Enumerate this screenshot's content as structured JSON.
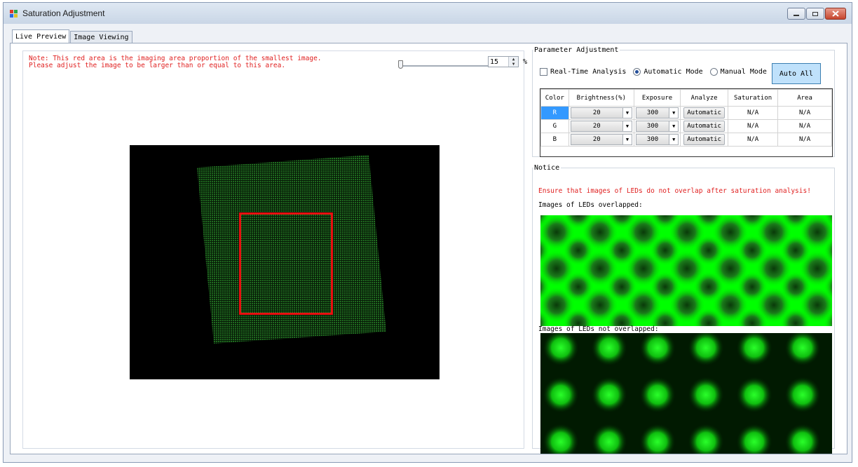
{
  "window": {
    "title": "Saturation Adjustment",
    "controls": [
      "minimize-icon",
      "maximize-icon",
      "close-icon"
    ]
  },
  "tabs": [
    {
      "label": "Live Preview",
      "active": true
    },
    {
      "label": "Image Viewing",
      "active": false
    }
  ],
  "preview": {
    "note_line1": "Note: This red area is the imaging area proportion of the smallest image.",
    "note_line2": "Please adjust the image to be larger than or equal to this area.",
    "slider_value": "15",
    "unit": "%",
    "note_color": "#e02020"
  },
  "parameter": {
    "legend": "Parameter Adjustment",
    "realtime_label": "Real-Time Analysis",
    "auto_mode_label": "Automatic Mode",
    "manual_mode_label": "Manual Mode",
    "auto_all_label": "Auto All",
    "selected_mode": "Automatic Mode",
    "columns": [
      "Color",
      "Brightness(%)",
      "Exposure",
      "Analyze",
      "Saturation",
      "Area"
    ],
    "rows": [
      {
        "color": "R",
        "brightness": "20",
        "exposure": "300",
        "analyze": "Automatic",
        "saturation": "N/A",
        "area": "N/A"
      },
      {
        "color": "G",
        "brightness": "20",
        "exposure": "300",
        "analyze": "Automatic",
        "saturation": "N/A",
        "area": "N/A"
      },
      {
        "color": "B",
        "brightness": "20",
        "exposure": "300",
        "analyze": "Automatic",
        "saturation": "N/A",
        "area": "N/A"
      }
    ]
  },
  "notice": {
    "legend": "Notice",
    "warning": "Ensure that images of LEDs do not overlap after saturation analysis!",
    "overlapped_label": "Images of LEDs overlapped:",
    "not_overlapped_label": "Images of LEDs not overlapped:"
  },
  "colors": {
    "selection": "#3399ff",
    "auto_all_bg": "#bfe1fb",
    "led_green": "#00ff00"
  }
}
